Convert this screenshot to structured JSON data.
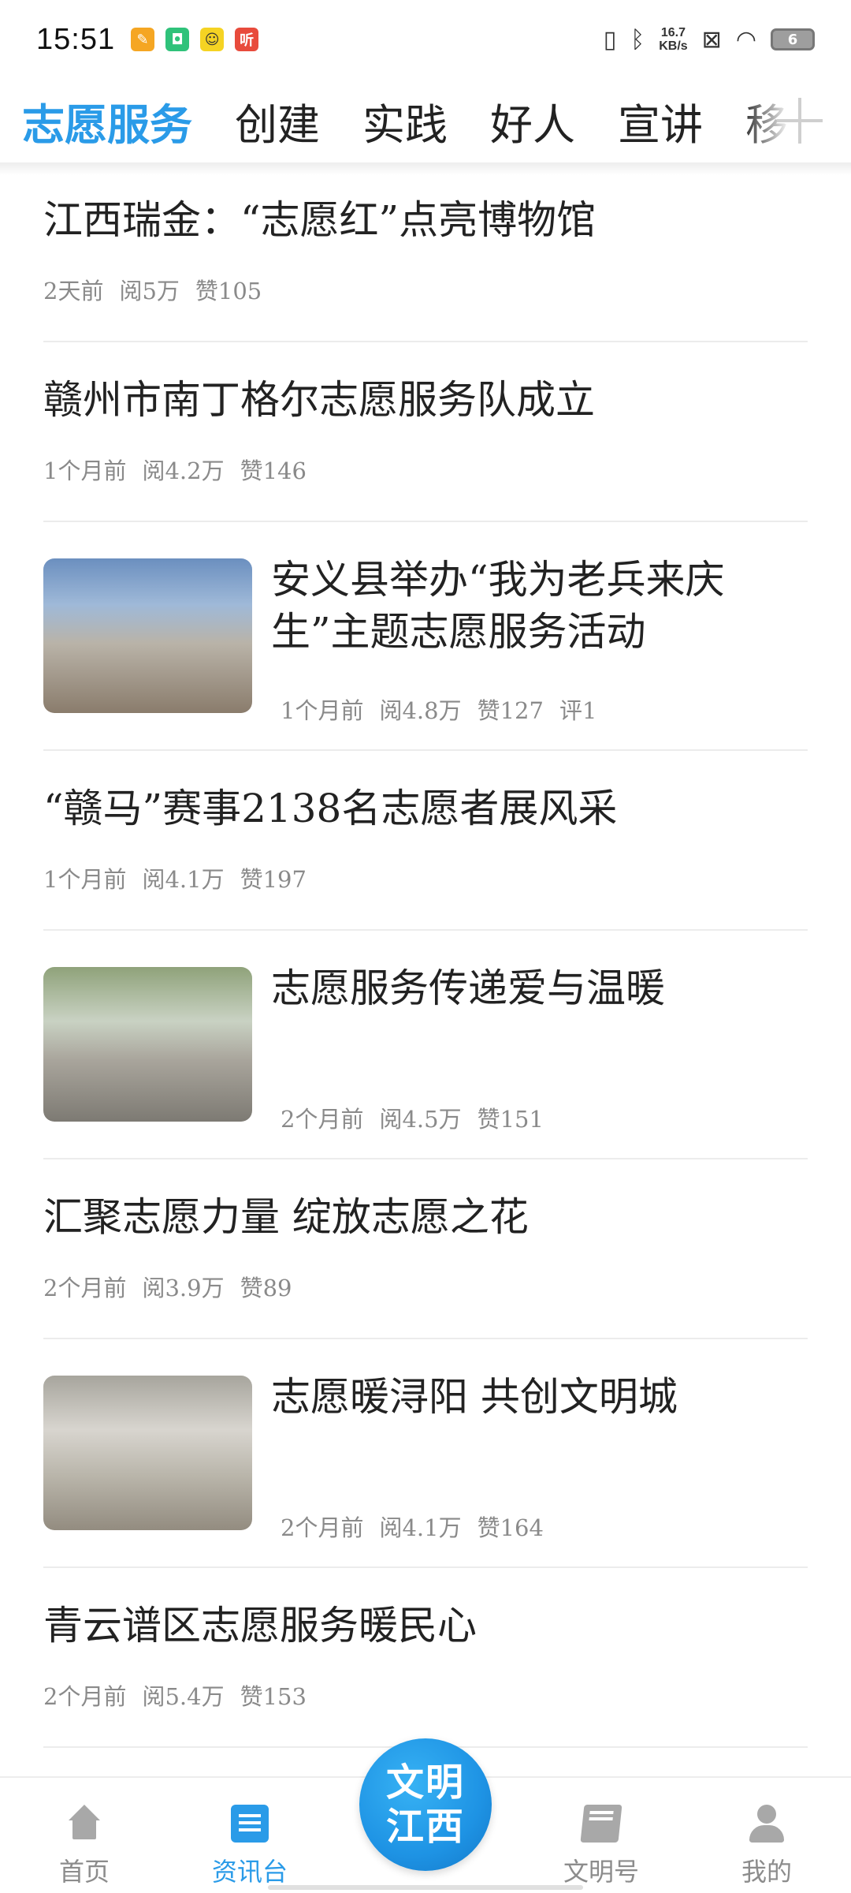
{
  "status_bar": {
    "time": "15:51",
    "notifications": [
      {
        "icon": "pencil-app-icon",
        "glyph": "✎",
        "color": "#f5a623"
      },
      {
        "icon": "shield-app-icon",
        "glyph": "◘",
        "color": "#2fc27a"
      },
      {
        "icon": "cartoon-app-icon",
        "glyph": "☺",
        "color": "#f5d323"
      },
      {
        "icon": "listen-app-icon",
        "glyph": "听",
        "color": "#e84b3c"
      }
    ],
    "net_speed_value": "16.7",
    "net_speed_unit": "KB/s",
    "battery": "6"
  },
  "tabs": [
    {
      "label": "志愿服务",
      "active": true
    },
    {
      "label": "创建",
      "active": false
    },
    {
      "label": "实践",
      "active": false
    },
    {
      "label": "好人",
      "active": false
    },
    {
      "label": "宣讲",
      "active": false
    },
    {
      "label": "移",
      "active": false
    }
  ],
  "articles": [
    {
      "title": "江西瑞金：“志愿红”点亮博物馆",
      "time": "2天前",
      "reads": "阅5万",
      "likes": "赞105"
    },
    {
      "title": "赣州市南丁格尔志愿服务队成立",
      "time": "1个月前",
      "reads": "阅4.2万",
      "likes": "赞146"
    },
    {
      "title": "安义县举办“我为老兵来庆生”主题志愿服务活动",
      "time": "1个月前",
      "reads": "阅4.8万",
      "likes": "赞127",
      "comments": "评1"
    },
    {
      "title": "“赣马”赛事2138名志愿者展风采",
      "time": "1个月前",
      "reads": "阅4.1万",
      "likes": "赞197"
    },
    {
      "title": "志愿服务传递爱与温暖",
      "time": "2个月前",
      "reads": "阅4.5万",
      "likes": "赞151"
    },
    {
      "title": "汇聚志愿力量  绽放志愿之花",
      "time": "2个月前",
      "reads": "阅3.9万",
      "likes": "赞89"
    },
    {
      "title": "志愿暖浔阳  共创文明城",
      "time": "2个月前",
      "reads": "阅4.1万",
      "likes": "赞164"
    },
    {
      "title": "青云谱区志愿服务暖民心",
      "time": "2个月前",
      "reads": "阅5.4万",
      "likes": "赞153"
    }
  ],
  "bottom_nav": {
    "home": "首页",
    "news": "资讯台",
    "center_line1": "文明",
    "center_line2": "江西",
    "wenming": "文明号",
    "mine": "我的"
  },
  "colors": {
    "accent": "#2a9be8",
    "meta_text": "#8a8a8a",
    "divider": "#ececec"
  }
}
